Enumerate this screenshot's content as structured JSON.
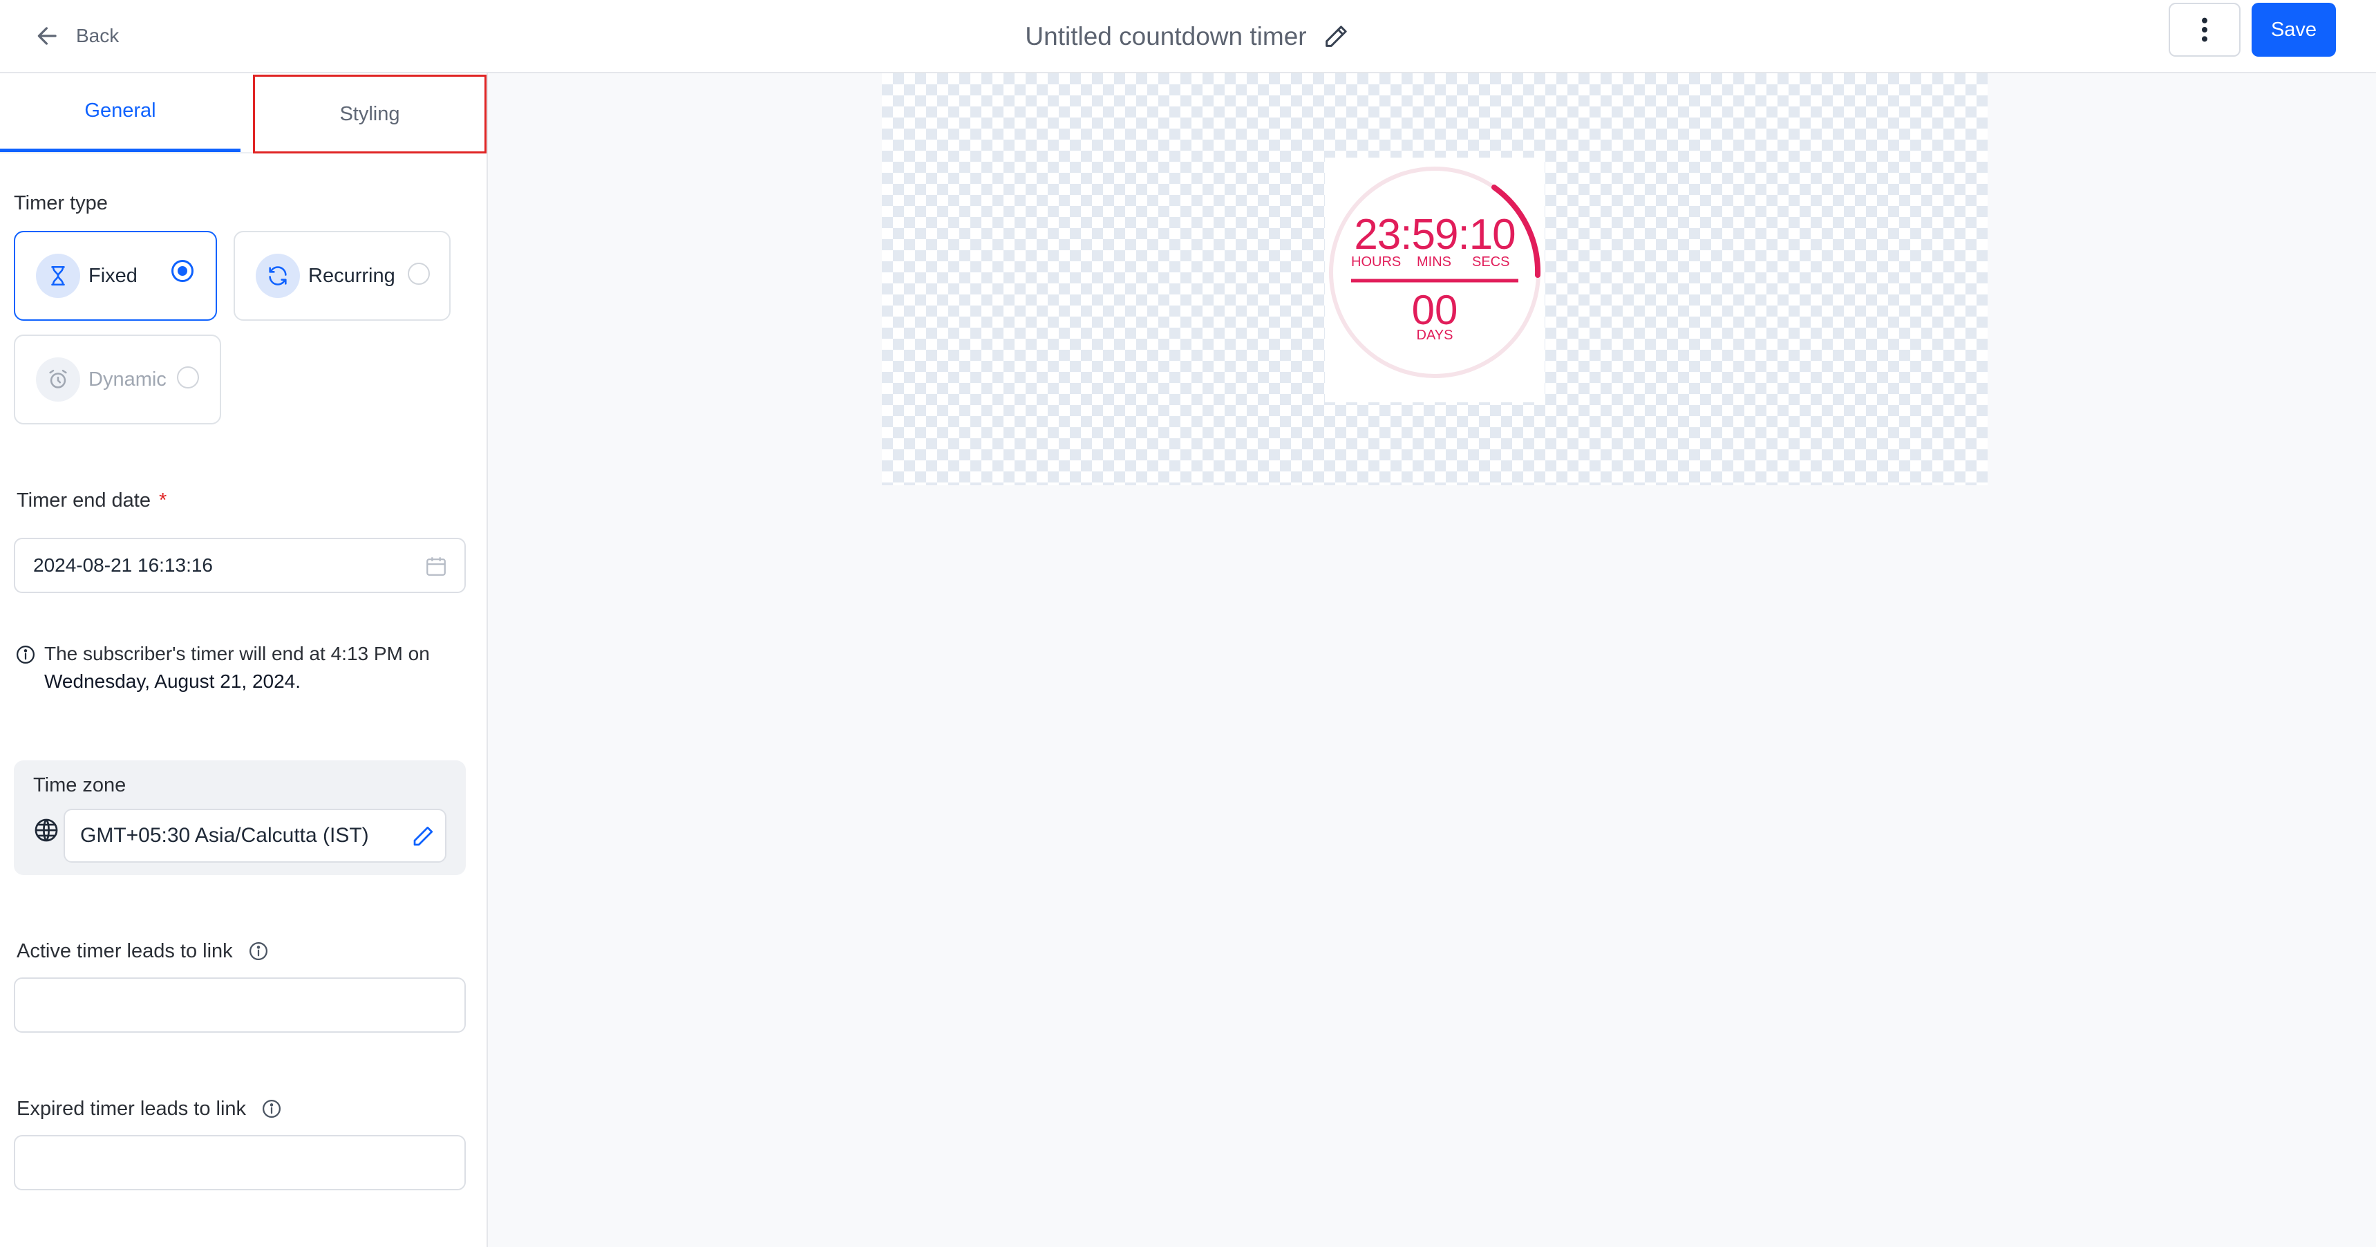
{
  "header": {
    "back_label": "Back",
    "title": "Untitled countdown timer",
    "save_label": "Save"
  },
  "tabs": [
    {
      "label": "General",
      "active": true
    },
    {
      "label": "Styling",
      "active": false
    }
  ],
  "timer_type": {
    "label": "Timer type",
    "options": [
      {
        "label": "Fixed",
        "selected": true,
        "disabled": false,
        "icon": "hourglass-icon"
      },
      {
        "label": "Recurring",
        "selected": false,
        "disabled": false,
        "icon": "refresh-icon"
      },
      {
        "label": "Dynamic",
        "selected": false,
        "disabled": true,
        "icon": "alarm-clock-icon"
      }
    ]
  },
  "end_date": {
    "label": "Timer end date",
    "required_mark": "*",
    "value": "2024-08-21 16:13:16",
    "info_prefix": "The subscriber's timer will end at 4:13 PM on",
    "info_date": "Wednesday, August 21, 2024."
  },
  "time_zone": {
    "label": "Time zone",
    "value": "GMT+05:30 Asia/Calcutta (IST)"
  },
  "active_link": {
    "label": "Active timer leads to link",
    "value": ""
  },
  "expired_link": {
    "label": "Expired timer leads to link",
    "value": ""
  },
  "preview": {
    "time": "23:59:10",
    "hours_label": "HOURS",
    "mins_label": "MINS",
    "secs_label": "SECS",
    "days": "00",
    "days_label": "DAYS",
    "accent_color": "#e11d5a"
  },
  "colors": {
    "primary": "#0f62fe",
    "highlight_box": "#e02424"
  }
}
